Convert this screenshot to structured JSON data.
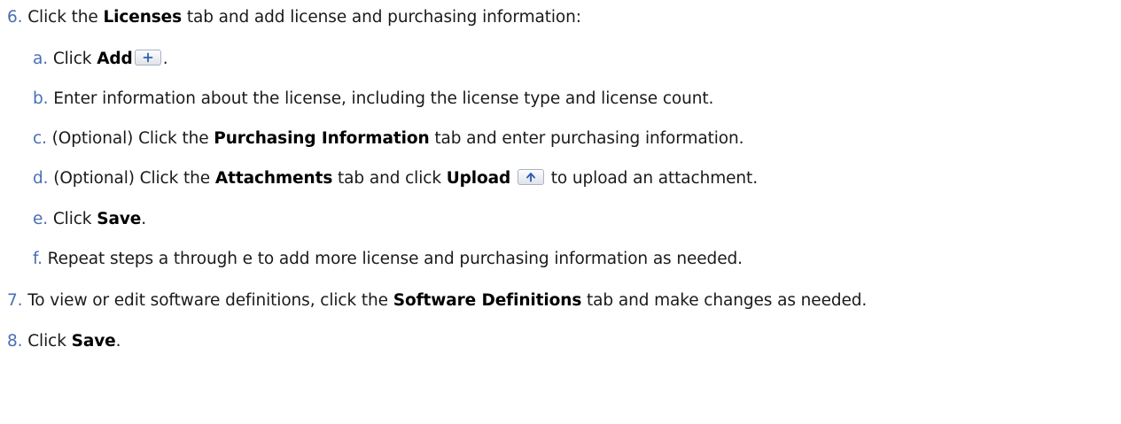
{
  "steps": [
    {
      "num": "6.",
      "parts": [
        "Click the",
        "Licenses",
        "tab and add license and purchasing information:"
      ],
      "substeps": [
        {
          "num": "a.",
          "parts": [
            "Click",
            "Add",
            "."
          ],
          "icon": "add-icon"
        },
        {
          "num": "b.",
          "text": "Enter information about the license, including the license type and license count."
        },
        {
          "num": "c.",
          "parts": [
            "(Optional) Click the",
            "Purchasing Information",
            "tab and enter purchasing information."
          ]
        },
        {
          "num": "d.",
          "parts": [
            "(Optional) Click the",
            "Attachments",
            "tab and click",
            "Upload",
            "to upload an attachment."
          ],
          "icon": "upload-icon"
        },
        {
          "num": "e.",
          "parts": [
            "Click",
            "Save",
            "."
          ]
        },
        {
          "num": "f.",
          "text": "Repeat steps a through e to add more license and purchasing information as needed."
        }
      ]
    },
    {
      "num": "7.",
      "parts": [
        "To view or edit software definitions, click the",
        "Software Definitions",
        "tab and make changes as needed."
      ]
    },
    {
      "num": "8.",
      "parts": [
        "Click",
        "Save",
        "."
      ]
    }
  ],
  "colors": {
    "step_number": "#4a6fb5",
    "icon_glyph": "#2f5fb3"
  }
}
